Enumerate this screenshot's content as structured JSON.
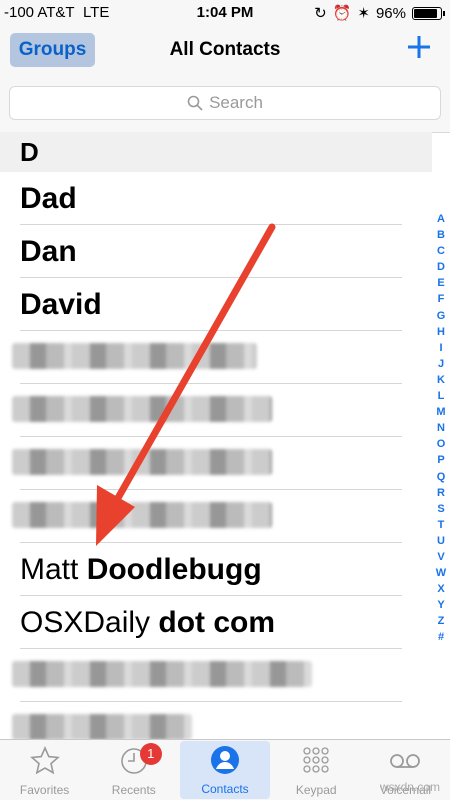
{
  "status": {
    "carrier": "-100 AT&T",
    "network": "LTE",
    "time": "1:04 PM",
    "battery": "96%",
    "battery_fill": 0.96
  },
  "nav": {
    "left_button": "Groups",
    "title": "All Contacts",
    "add_icon": "plus-icon"
  },
  "search": {
    "placeholder": "Search"
  },
  "section": {
    "letter": "D"
  },
  "contacts": [
    {
      "first": "",
      "last": "Dad",
      "blurred": false
    },
    {
      "first": "",
      "last": "Dan",
      "blurred": false
    },
    {
      "first": "",
      "last": "David",
      "blurred": false
    },
    {
      "first": "",
      "last": "",
      "blurred": true
    },
    {
      "first": "",
      "last": "",
      "blurred": true
    },
    {
      "first": "",
      "last": "",
      "blurred": true
    },
    {
      "first": "",
      "last": "",
      "blurred": true
    },
    {
      "first": "Matt",
      "last": "Doodlebugg",
      "blurred": false
    },
    {
      "first": "OSXDaily",
      "last": "dot com",
      "blurred": false
    },
    {
      "first": "",
      "last": "",
      "blurred": true
    },
    {
      "first": "",
      "last": "",
      "blurred": true
    }
  ],
  "index_letters": [
    "A",
    "B",
    "C",
    "D",
    "E",
    "F",
    "G",
    "H",
    "I",
    "J",
    "K",
    "L",
    "M",
    "N",
    "O",
    "P",
    "Q",
    "R",
    "S",
    "T",
    "U",
    "V",
    "W",
    "X",
    "Y",
    "Z",
    "#"
  ],
  "tabs": [
    {
      "label": "Favorites",
      "icon": "star-icon",
      "active": false
    },
    {
      "label": "Recents",
      "icon": "clock-icon",
      "active": false,
      "badge": "1"
    },
    {
      "label": "Contacts",
      "icon": "person-icon",
      "active": true
    },
    {
      "label": "Keypad",
      "icon": "keypad-icon",
      "active": false
    },
    {
      "label": "Voicemail",
      "icon": "voicemail-icon",
      "active": false
    }
  ],
  "colors": {
    "accent": "#1a73e8",
    "arrow": "#e8412d",
    "badge": "#e53935"
  },
  "watermark": "wsxdn.com"
}
